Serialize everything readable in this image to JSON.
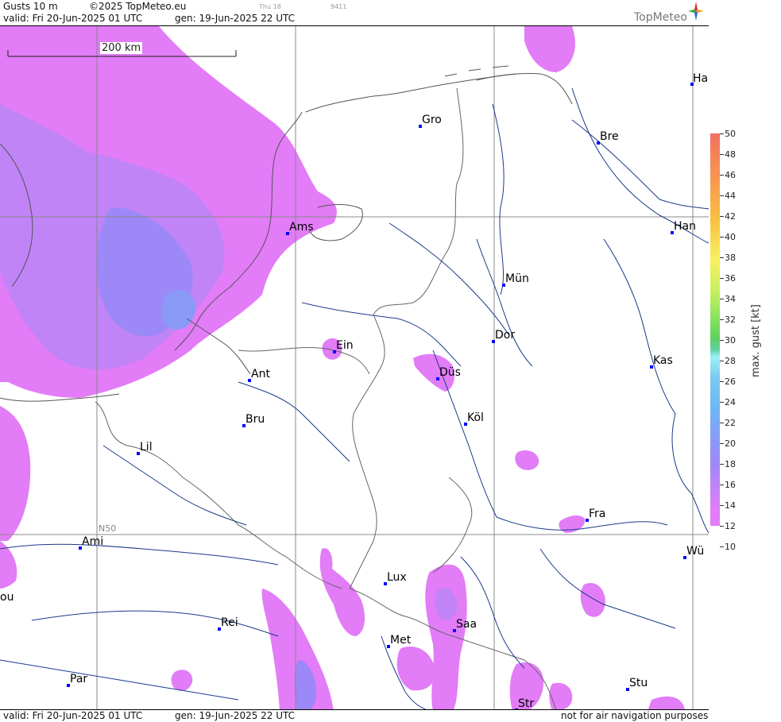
{
  "header": {
    "title": "Gusts 10 m",
    "copyright": "©2025 TopMeteo.eu",
    "day_tag": "Thu 18",
    "code_tag": "9411",
    "valid": "valid:  Fri  20-Jun-2025  01 UTC",
    "gen": "gen: 19-Jun-2025 22 UTC",
    "logo": "TopMeteo"
  },
  "map": {
    "scale_label": "200 km",
    "lat_label": "N50",
    "cities": [
      {
        "label": "Ha"
      },
      {
        "label": "Gro"
      },
      {
        "label": "Bre"
      },
      {
        "label": "Ams"
      },
      {
        "label": "Han"
      },
      {
        "label": "Mün"
      },
      {
        "label": "Ein"
      },
      {
        "label": "Dor"
      },
      {
        "label": "Ant"
      },
      {
        "label": "Düs"
      },
      {
        "label": "Kas"
      },
      {
        "label": "Bru"
      },
      {
        "label": "Köl"
      },
      {
        "label": "Lil"
      },
      {
        "label": "Fra"
      },
      {
        "label": "Ami"
      },
      {
        "label": "Wü"
      },
      {
        "label": "ou"
      },
      {
        "label": "Lux"
      },
      {
        "label": "Rei"
      },
      {
        "label": "Saa"
      },
      {
        "label": "Met"
      },
      {
        "label": "Par"
      },
      {
        "label": "Stu"
      },
      {
        "label": "Str"
      }
    ]
  },
  "footer": {
    "valid": "valid:  Fri  20-Jun-2025  01 UTC",
    "gen": "gen: 19-Jun-2025 22 UTC",
    "note": "not for air navigation purposes"
  },
  "legend": {
    "title": "max. gust [kt]",
    "ticks": [
      "50",
      "48",
      "46",
      "44",
      "42",
      "40",
      "38",
      "36",
      "34",
      "32",
      "30",
      "28",
      "26",
      "24",
      "22",
      "20",
      "18",
      "16",
      "14",
      "12",
      "10"
    ],
    "colors": {
      "gust_12_14": "#e27cf7",
      "gust_14_16": "#c084f7",
      "gust_16_18": "#9d88f7",
      "gust_18_22": "#8a9af6",
      "gust_22_26": "#6db8f3"
    }
  }
}
